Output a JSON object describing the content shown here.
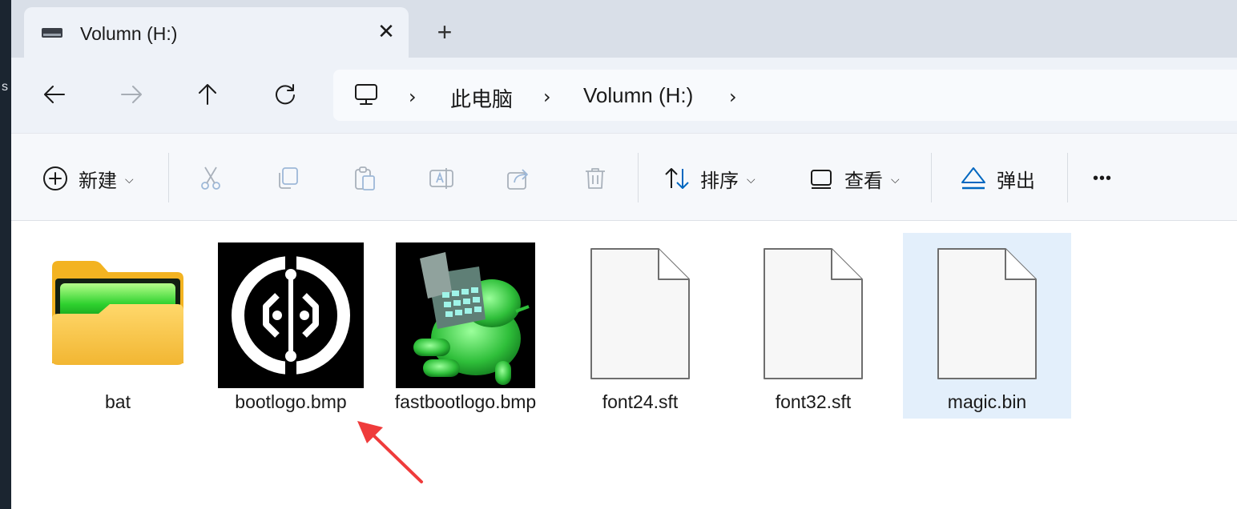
{
  "side": {
    "letter": "s"
  },
  "tab": {
    "title": "Volumn (H:)",
    "close_glyph": "✕"
  },
  "new_tab_glyph": "+",
  "nav": {
    "back_icon": "arrow-left-icon",
    "forward_icon": "arrow-right-icon",
    "up_icon": "arrow-up-icon",
    "refresh_icon": "refresh-icon"
  },
  "address": {
    "crumbs": [
      "此电脑",
      "Volumn (H:)"
    ],
    "separator": "›"
  },
  "toolbar": {
    "new_label": "新建",
    "sort_label": "排序",
    "view_label": "查看",
    "eject_label": "弹出",
    "more_glyph": "•••",
    "caret": "⌵"
  },
  "files": [
    {
      "name": "bat",
      "type": "folder"
    },
    {
      "name": "bootlogo.bmp",
      "type": "image"
    },
    {
      "name": "fastbootlogo.bmp",
      "type": "image"
    },
    {
      "name": "font24.sft",
      "type": "file"
    },
    {
      "name": "font32.sft",
      "type": "file"
    },
    {
      "name": "magic.bin",
      "type": "file",
      "selected": true
    }
  ],
  "colors": {
    "accent": "#0067c0",
    "annotation_arrow": "#ef3b3b",
    "selection": "#e3effb"
  }
}
